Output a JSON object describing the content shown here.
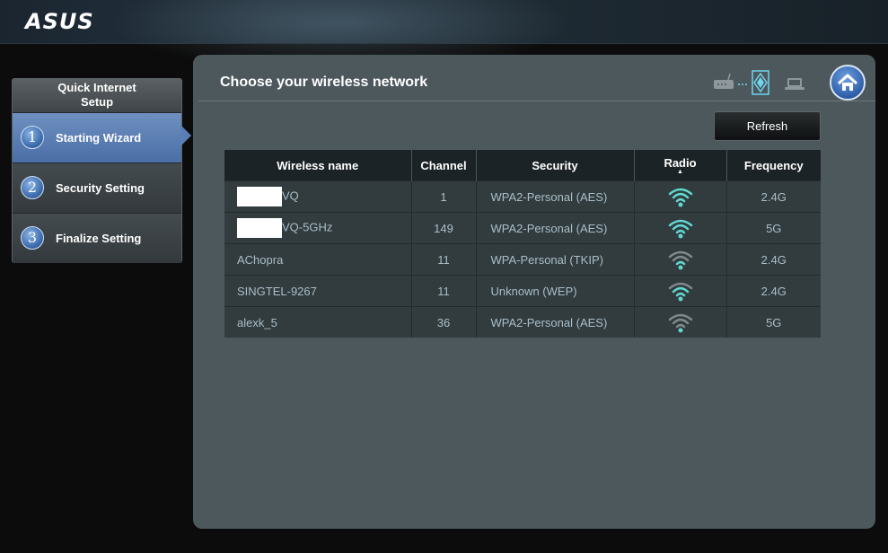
{
  "brand": {
    "logo": "ASUS"
  },
  "sidebar": {
    "title_line1": "Quick Internet",
    "title_line2": "Setup",
    "steps": [
      {
        "num": "1",
        "label": "Starting Wizard",
        "active": true
      },
      {
        "num": "2",
        "label": "Security Setting",
        "active": false
      },
      {
        "num": "3",
        "label": "Finalize Setting",
        "active": false
      }
    ]
  },
  "main": {
    "title": "Choose your wireless network",
    "refresh_label": "Refresh",
    "icons": [
      "router-icon",
      "wireless-link-icon",
      "laptop-icon",
      "home-icon"
    ]
  },
  "table": {
    "headers": {
      "name": "Wireless name",
      "channel": "Channel",
      "security": "Security",
      "radio": "Radio",
      "frequency": "Frequency"
    },
    "rows": [
      {
        "name": "VQ",
        "masked": true,
        "channel": "1",
        "security": "WPA2-Personal (AES)",
        "signal": 4,
        "frequency": "2.4G"
      },
      {
        "name": "VQ-5GHz",
        "masked": true,
        "channel": "149",
        "security": "WPA2-Personal (AES)",
        "signal": 4,
        "frequency": "5G"
      },
      {
        "name": "AChopra",
        "masked": false,
        "channel": "11",
        "security": "WPA-Personal (TKIP)",
        "signal": 2,
        "frequency": "2.4G"
      },
      {
        "name": "SINGTEL-9267",
        "masked": false,
        "channel": "11",
        "security": "Unknown (WEP)",
        "signal": 3,
        "frequency": "2.4G"
      },
      {
        "name": "alexk_5",
        "masked": false,
        "channel": "36",
        "security": "WPA2-Personal (AES)",
        "signal": 1,
        "frequency": "5G"
      }
    ]
  },
  "colors": {
    "signal_on": "#5fd9d0",
    "signal_off": "#7f8a8e",
    "accent": "#4a6fa6"
  }
}
